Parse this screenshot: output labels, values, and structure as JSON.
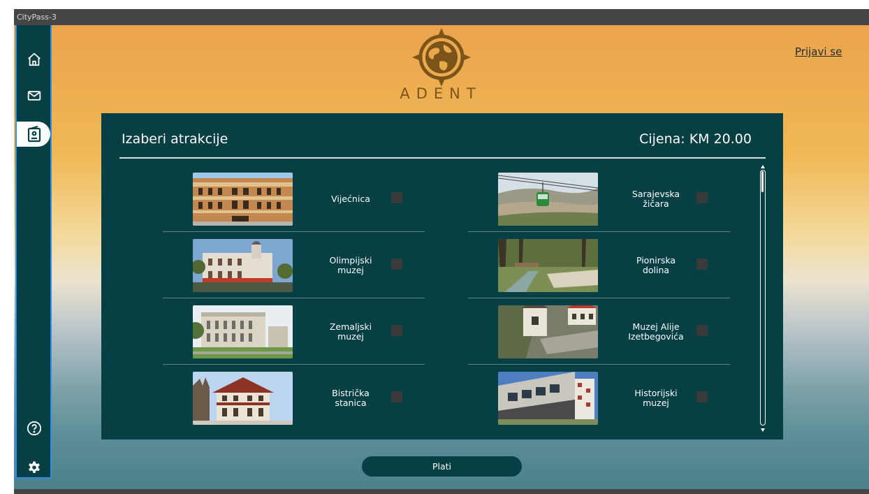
{
  "window": {
    "title": "CityPass-3"
  },
  "sidebar": {
    "items": [
      {
        "icon": "home-icon"
      },
      {
        "icon": "mail-icon"
      },
      {
        "icon": "pass-icon",
        "active": true
      },
      {
        "icon": "help-icon"
      },
      {
        "icon": "settings-icon"
      }
    ]
  },
  "brand": {
    "logo_text": "ADENT"
  },
  "header": {
    "login_label": "Prijavi se"
  },
  "panel": {
    "title": "Izaberi atrakcije",
    "price": "Cijena: KM 20.00"
  },
  "attractions": [
    {
      "name": "Vijećnica",
      "checked": false
    },
    {
      "name": "Sarajevska\nžičara",
      "checked": false
    },
    {
      "name": "Olimpijski\nmuzej",
      "checked": false
    },
    {
      "name": "Pionirska\ndolina",
      "checked": false
    },
    {
      "name": "Zemaljski\nmuzej",
      "checked": false
    },
    {
      "name": "Muzej Alije\nIzetbegovića",
      "checked": false
    },
    {
      "name": "Bistrička\nstanica",
      "checked": false
    },
    {
      "name": "Historijski\nmuzej",
      "checked": false
    }
  ],
  "footer": {
    "pay_label": "Plati"
  },
  "colors": {
    "panel_bg": "#063f44",
    "sidebar_border": "#2f8fe5",
    "checkbox": "#3a3a3a",
    "logo": "#7a5418"
  }
}
